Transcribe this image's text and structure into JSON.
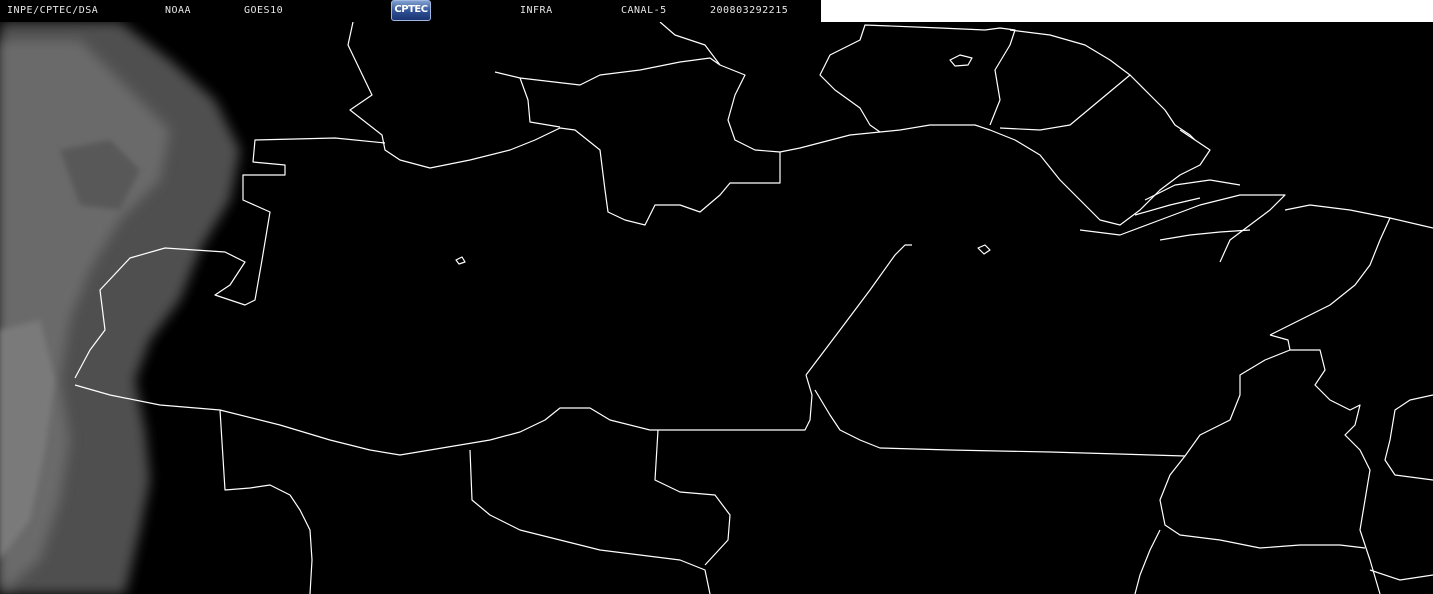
{
  "header": {
    "institution": "INPE/CPTEC/DSA",
    "agency": "NOAA",
    "satellite": "GOES10",
    "logo_text": "CPTEC",
    "product": "INFRA",
    "channel": "CANAL-5",
    "timestamp": "200803292215"
  },
  "colors": {
    "background": "#000000",
    "borders": "#ffffff",
    "header_text": "#e6e6e6",
    "clouds": "#6e6e6e"
  }
}
